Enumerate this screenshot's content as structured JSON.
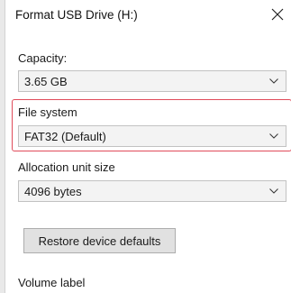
{
  "dialog": {
    "title": "Format USB Drive (H:)",
    "close_icon": "close-icon"
  },
  "capacity": {
    "label": "Capacity:",
    "value": "3.65 GB"
  },
  "file_system": {
    "label": "File system",
    "value": "FAT32 (Default)",
    "highlight_color": "#e04b5a"
  },
  "allocation": {
    "label": "Allocation unit size",
    "value": "4096 bytes"
  },
  "restore_button": {
    "label": "Restore device defaults"
  },
  "volume_label": {
    "label": "Volume label"
  }
}
